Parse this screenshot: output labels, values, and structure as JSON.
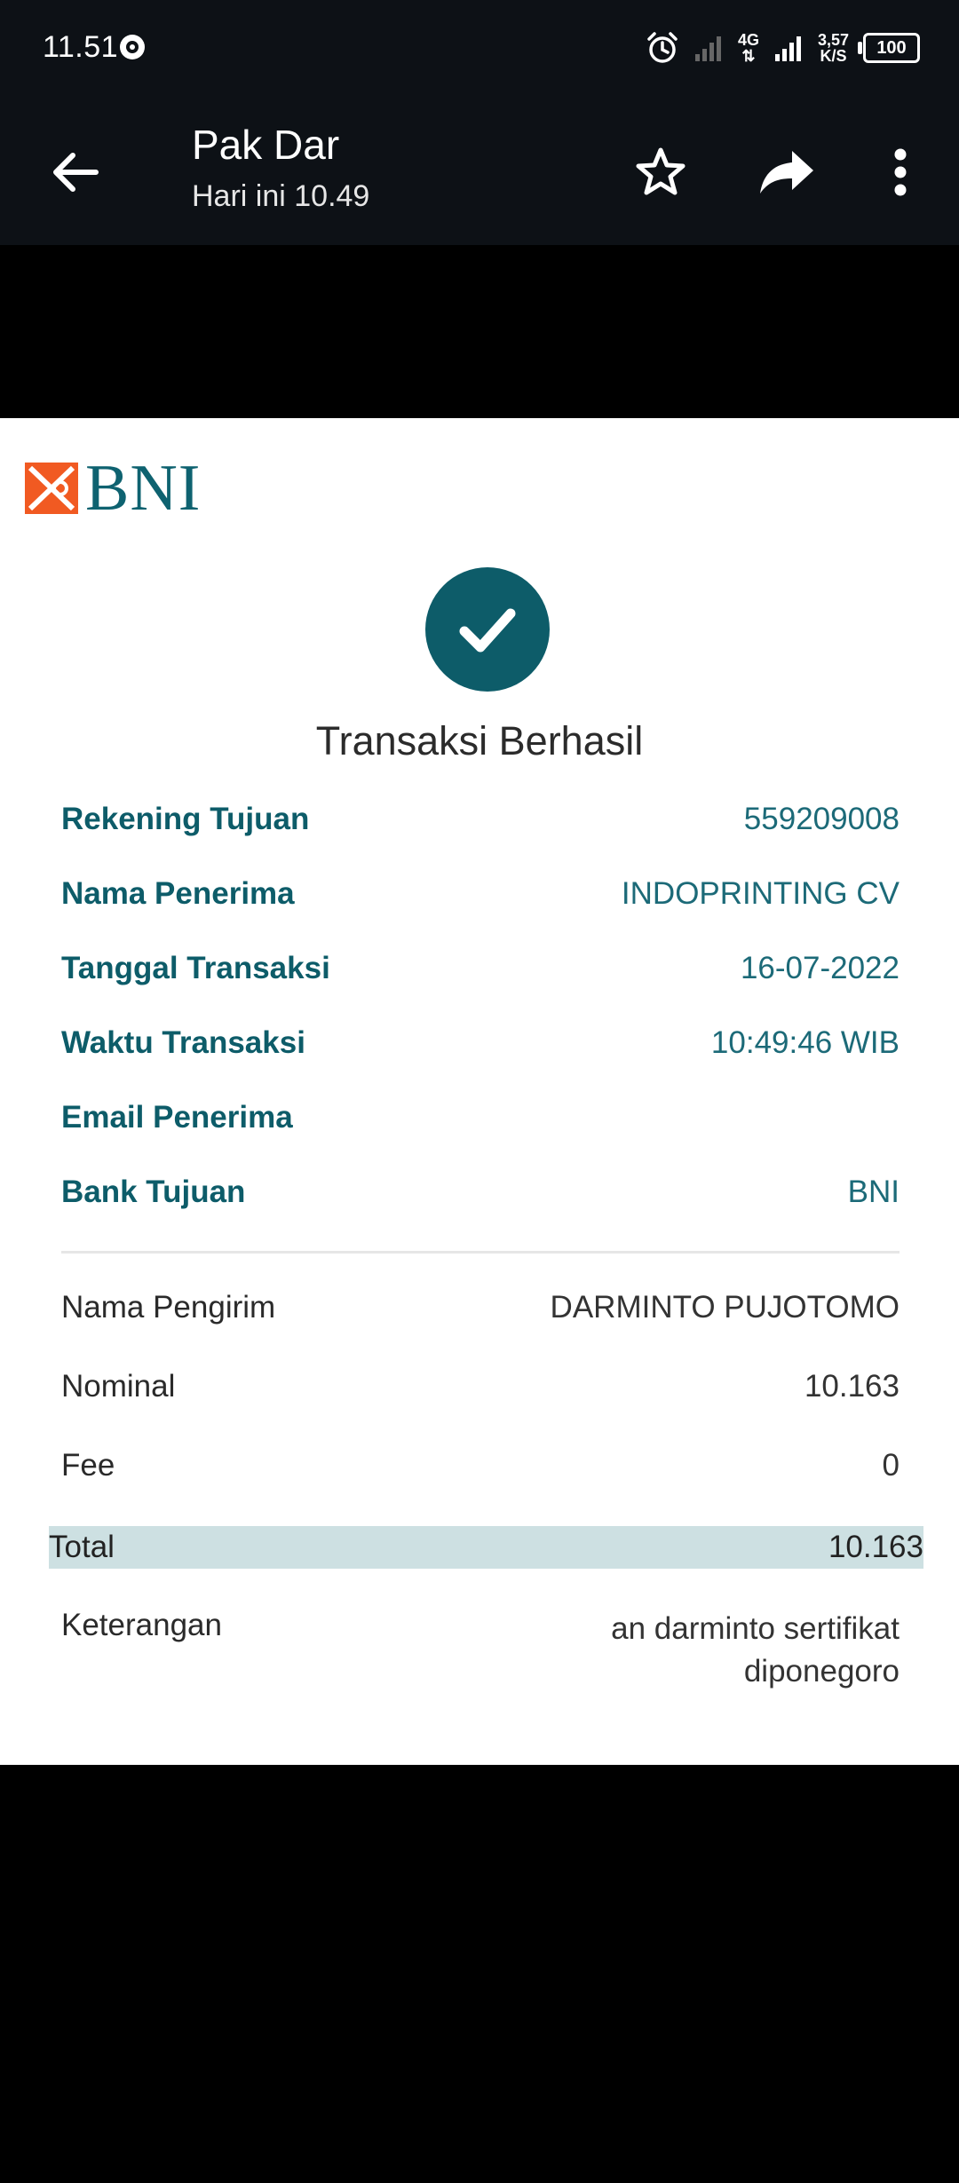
{
  "status_bar": {
    "time": "11.51",
    "network": "4G",
    "speed_value": "3,57",
    "speed_unit": "K/S",
    "battery": "100"
  },
  "app_bar": {
    "title": "Pak Dar",
    "subtitle": "Hari ini 10.49"
  },
  "receipt": {
    "bank_name": "BNI",
    "status": "Transaksi Berhasil",
    "details": [
      {
        "label": "Rekening Tujuan",
        "value": "559209008"
      },
      {
        "label": "Nama Penerima",
        "value": "INDOPRINTING CV"
      },
      {
        "label": "Tanggal Transaksi",
        "value": "16-07-2022"
      },
      {
        "label": "Waktu Transaksi",
        "value": "10:49:46 WIB"
      },
      {
        "label": "Email Penerima",
        "value": ""
      },
      {
        "label": "Bank Tujuan",
        "value": "BNI"
      }
    ],
    "summary": [
      {
        "label": "Nama Pengirim",
        "value": "DARMINTO PUJOTOMO"
      },
      {
        "label": "Nominal",
        "value": "10.163"
      },
      {
        "label": "Fee",
        "value": "0"
      }
    ],
    "total": {
      "label": "Total",
      "value": "10.163"
    },
    "note": {
      "label": "Keterangan",
      "line1": "an darminto sertifikat",
      "line2": "diponegoro"
    }
  },
  "colors": {
    "bar_bg": "#0d1116",
    "brand_teal": "#0d5c69",
    "bni_orange": "#f15a22",
    "total_bg": "#cde0e2"
  }
}
